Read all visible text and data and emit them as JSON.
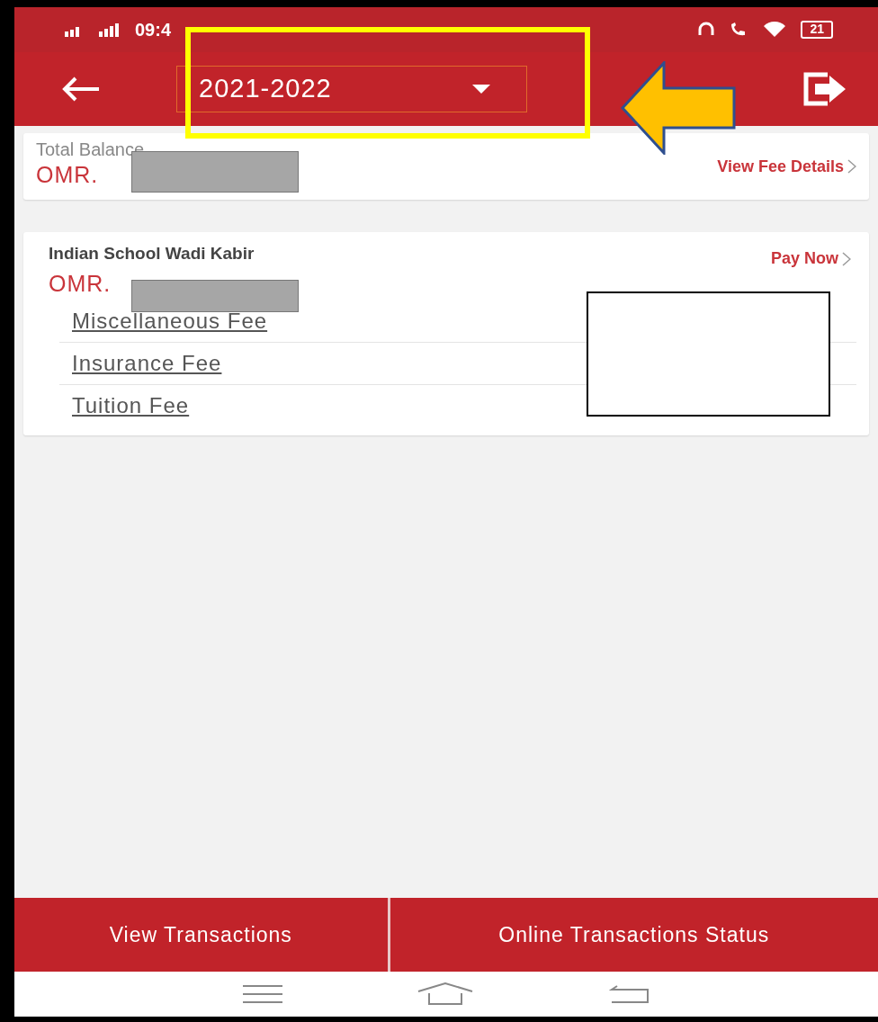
{
  "status_bar": {
    "time": "09:4",
    "battery": "21"
  },
  "app_bar": {
    "year_select": {
      "value": "2021-2022"
    }
  },
  "total_balance": {
    "label": "Total Balance",
    "currency": "OMR.",
    "link": "View Fee Details"
  },
  "school": {
    "name": "Indian School Wadi Kabir",
    "currency": "OMR.",
    "link": "Pay Now",
    "fees": [
      {
        "label": "Miscellaneous Fee"
      },
      {
        "label": "Insurance Fee"
      },
      {
        "label": "Tuition Fee"
      }
    ]
  },
  "bottom_buttons": [
    {
      "label": "View Transactions"
    },
    {
      "label": "Online Transactions Status"
    }
  ]
}
